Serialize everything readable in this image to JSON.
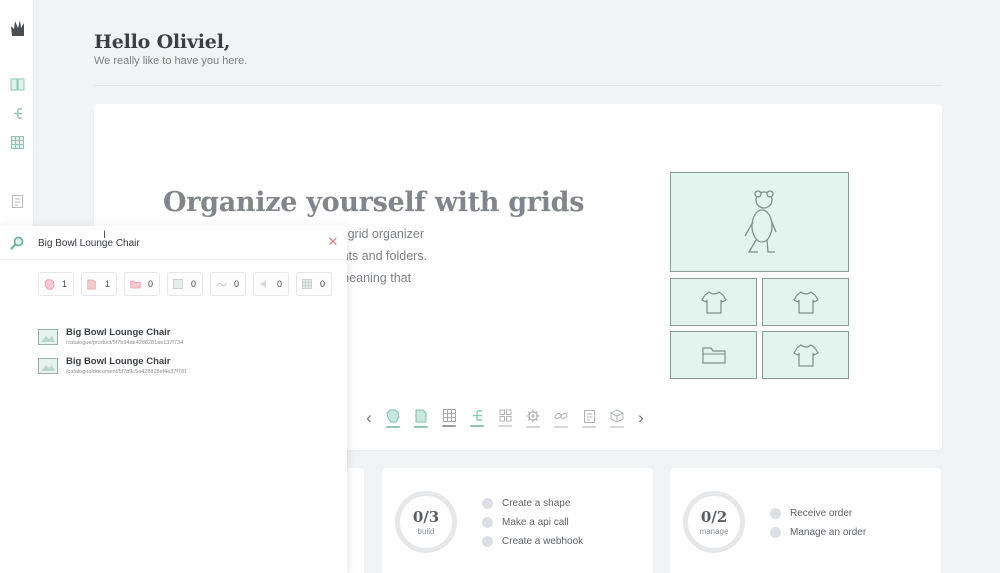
{
  "header": {
    "greeting": "Hello Oliviel,",
    "subtitle": "We really like to have you here."
  },
  "hero": {
    "title": "Organize yourself with grids",
    "lines": [
      "ee organizer can be limiting. The grid organizer",
      "for organizing products, documents and folders.",
      "ic grid where you can apply the meaning that"
    ]
  },
  "carousel": {
    "icons": [
      "product-icon",
      "document-icon",
      "grid-icon",
      "tree-icon",
      "shapes-icon",
      "settings-icon",
      "link-icon",
      "clipboard-icon",
      "box-icon"
    ]
  },
  "cards": [
    {
      "count": "0/3",
      "label": "build",
      "tasks": [
        "Create a shape",
        "Make a api call",
        "Create a webhook"
      ]
    },
    {
      "count": "0/2",
      "label": "manage",
      "tasks": [
        "Receive order",
        "Manage an order"
      ]
    }
  ],
  "search": {
    "query": "Big Bowl Lounge Chair",
    "filters": [
      {
        "icon": "product-icon",
        "count": "1"
      },
      {
        "icon": "document-icon",
        "count": "1"
      },
      {
        "icon": "folder-icon",
        "count": "0"
      },
      {
        "icon": "grid-icon",
        "count": "0"
      },
      {
        "icon": "link-icon",
        "count": "0"
      },
      {
        "icon": "shape-icon",
        "count": "0"
      },
      {
        "icon": "pattern-icon",
        "count": "0"
      }
    ],
    "results": [
      {
        "name": "Big Bowl Lounge Chair",
        "path": "/catalogue/product/5f7b94ae4288281ae137f734"
      },
      {
        "name": "Big Bowl Lounge Chair",
        "path": "/catalogue/document/5f7b9c5a428828ef4e37f781"
      }
    ]
  },
  "colors": {
    "accent": "#8fc7b6",
    "accent_bg": "#e3f4ef",
    "danger": "#e07a86"
  }
}
